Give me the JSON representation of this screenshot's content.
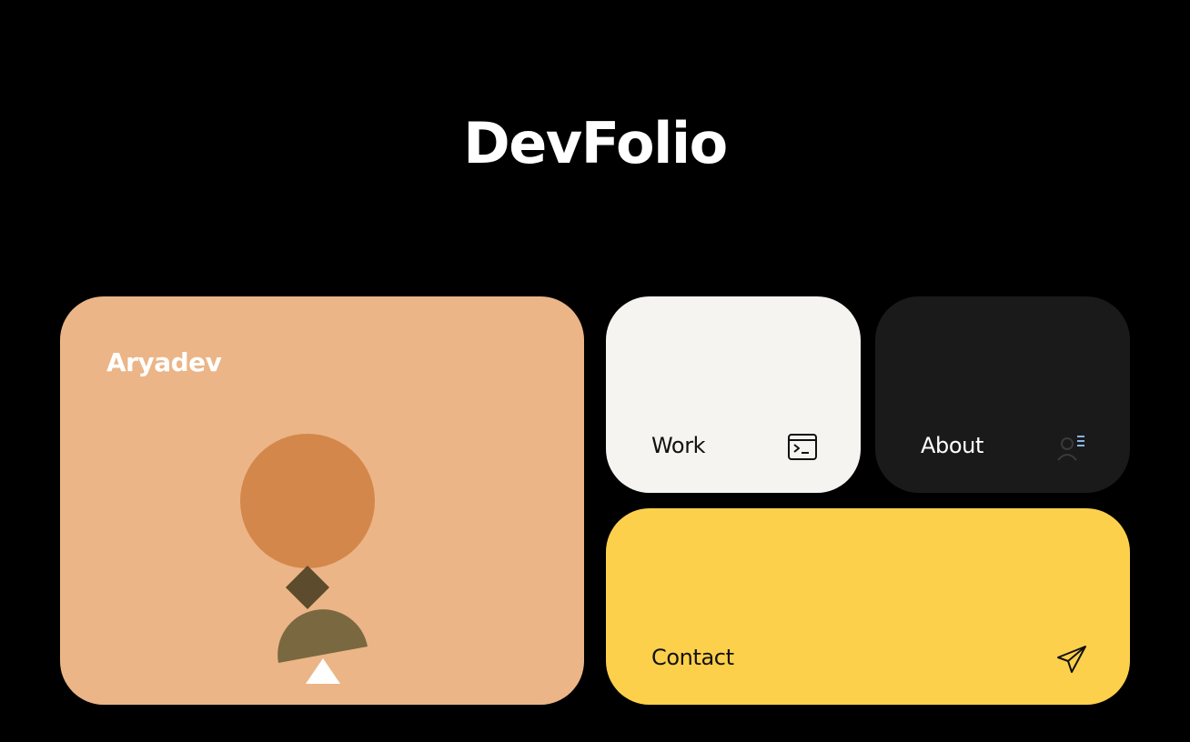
{
  "site": {
    "title": "DevFolio"
  },
  "profile": {
    "name": "Aryadev",
    "background_color": "#ebb587"
  },
  "nav_cards": {
    "work": {
      "label": "Work",
      "icon": "terminal-icon",
      "color": "#f5f4f0"
    },
    "about": {
      "label": "About",
      "icon": "user-list-icon",
      "color": "#1a1a1a"
    },
    "contact": {
      "label": "Contact",
      "icon": "send-icon",
      "color": "#fdd04b"
    }
  }
}
